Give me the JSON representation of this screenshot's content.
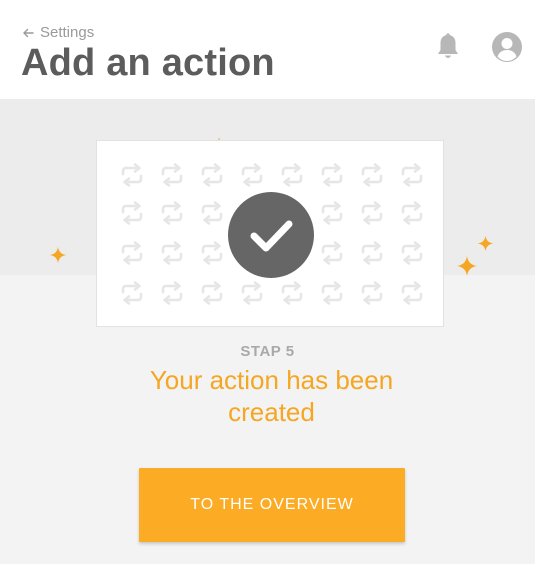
{
  "header": {
    "back_label": "Settings",
    "title": "Add an action",
    "icons": [
      "arrow-left-icon",
      "bell-icon",
      "user-avatar-icon"
    ]
  },
  "main": {
    "step_label": "STAP 5",
    "success_message": "Your action has been created",
    "overview_button_label": "TO THE OVERVIEW",
    "illustration_icons": [
      "repeat-arrows-icon",
      "checkmark-icon",
      "sparkle-icon"
    ]
  },
  "colors": {
    "accent": "#fbab24",
    "accent_text": "#f5a623",
    "title": "#5c5c5c",
    "muted": "#a9a9a9",
    "badge": "#666666",
    "background": "#f3f3f3"
  }
}
